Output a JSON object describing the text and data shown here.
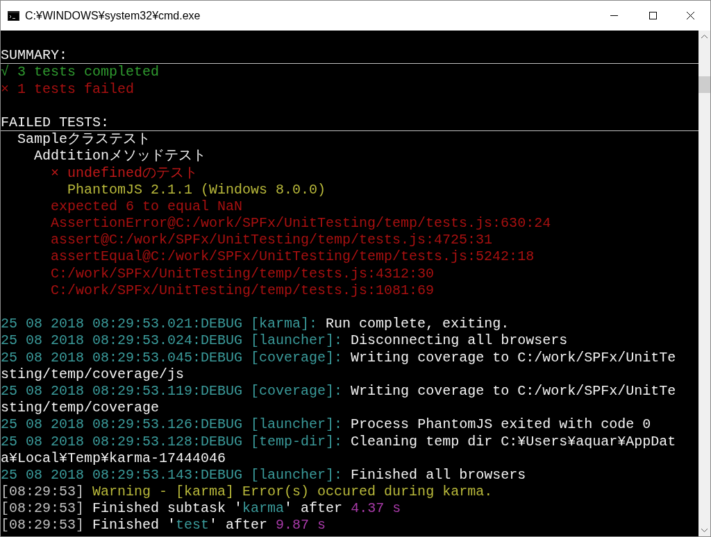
{
  "window": {
    "title": "C:¥WINDOWS¥system32¥cmd.exe"
  },
  "lines": [
    {
      "kind": "blank"
    },
    {
      "kind": "heading",
      "segments": [
        {
          "text": "SUMMARY:",
          "color": "#f2f2f2"
        }
      ]
    },
    {
      "kind": "text",
      "segments": [
        {
          "text": "√ 3 tests completed",
          "color": "#2f9a2f"
        }
      ]
    },
    {
      "kind": "text",
      "segments": [
        {
          "text": "× 1 tests failed",
          "color": "#a81010"
        }
      ]
    },
    {
      "kind": "blank"
    },
    {
      "kind": "heading",
      "segments": [
        {
          "text": "FAILED TESTS:",
          "color": "#f2f2f2"
        }
      ]
    },
    {
      "kind": "text",
      "segments": [
        {
          "text": "  Sampleクラステスト",
          "color": "#f2f2f2"
        }
      ]
    },
    {
      "kind": "text",
      "segments": [
        {
          "text": "    Addtitionメソッドテスト",
          "color": "#f2f2f2"
        }
      ]
    },
    {
      "kind": "text",
      "segments": [
        {
          "text": "      × undefinedのテスト",
          "color": "#c01818"
        }
      ]
    },
    {
      "kind": "text",
      "segments": [
        {
          "text": "        PhantomJS 2.1.1 (Windows 8.0.0)",
          "color": "#b8b83a"
        }
      ]
    },
    {
      "kind": "text",
      "segments": [
        {
          "text": "      expected 6 to equal NaN",
          "color": "#a81010"
        }
      ]
    },
    {
      "kind": "text",
      "segments": [
        {
          "text": "      AssertionError@C:/work/SPFx/UnitTesting/temp/tests.js:630:24",
          "color": "#a81010"
        }
      ]
    },
    {
      "kind": "text",
      "segments": [
        {
          "text": "      assert@C:/work/SPFx/UnitTesting/temp/tests.js:4725:31",
          "color": "#a81010"
        }
      ]
    },
    {
      "kind": "text",
      "segments": [
        {
          "text": "      assertEqual@C:/work/SPFx/UnitTesting/temp/tests.js:5242:18",
          "color": "#a81010"
        }
      ]
    },
    {
      "kind": "text",
      "segments": [
        {
          "text": "      C:/work/SPFx/UnitTesting/temp/tests.js:4312:30",
          "color": "#a81010"
        }
      ]
    },
    {
      "kind": "text",
      "segments": [
        {
          "text": "      C:/work/SPFx/UnitTesting/temp/tests.js:1081:69",
          "color": "#a81010"
        }
      ]
    },
    {
      "kind": "blank"
    },
    {
      "kind": "text",
      "segments": [
        {
          "text": "25 08 2018 08:29:53.021:DEBUG [karma]:",
          "color": "#3a9a9a"
        },
        {
          "text": " Run complete, exiting.",
          "color": "#f2f2f2"
        }
      ]
    },
    {
      "kind": "text",
      "segments": [
        {
          "text": "25 08 2018 08:29:53.024:DEBUG [launcher]:",
          "color": "#3a9a9a"
        },
        {
          "text": " Disconnecting all browsers",
          "color": "#f2f2f2"
        }
      ]
    },
    {
      "kind": "text",
      "segments": [
        {
          "text": "25 08 2018 08:29:53.045:DEBUG [coverage]:",
          "color": "#3a9a9a"
        },
        {
          "text": " Writing coverage to C:/work/SPFx/UnitTe",
          "color": "#f2f2f2"
        }
      ]
    },
    {
      "kind": "text",
      "segments": [
        {
          "text": "sting/temp/coverage/js",
          "color": "#f2f2f2"
        }
      ]
    },
    {
      "kind": "text",
      "segments": [
        {
          "text": "25 08 2018 08:29:53.119:DEBUG [coverage]:",
          "color": "#3a9a9a"
        },
        {
          "text": " Writing coverage to C:/work/SPFx/UnitTe",
          "color": "#f2f2f2"
        }
      ]
    },
    {
      "kind": "text",
      "segments": [
        {
          "text": "sting/temp/coverage",
          "color": "#f2f2f2"
        }
      ]
    },
    {
      "kind": "text",
      "segments": [
        {
          "text": "25 08 2018 08:29:53.126:DEBUG [launcher]:",
          "color": "#3a9a9a"
        },
        {
          "text": " Process PhantomJS exited with code 0",
          "color": "#f2f2f2"
        }
      ]
    },
    {
      "kind": "text",
      "segments": [
        {
          "text": "25 08 2018 08:29:53.128:DEBUG [temp-dir]:",
          "color": "#3a9a9a"
        },
        {
          "text": " Cleaning temp dir C:¥Users¥aquar¥AppDat",
          "color": "#f2f2f2"
        }
      ]
    },
    {
      "kind": "text",
      "segments": [
        {
          "text": "a¥Local¥Temp¥karma-17444046",
          "color": "#f2f2f2"
        }
      ]
    },
    {
      "kind": "text",
      "segments": [
        {
          "text": "25 08 2018 08:29:53.143:DEBUG [launcher]:",
          "color": "#3a9a9a"
        },
        {
          "text": " Finished all browsers",
          "color": "#f2f2f2"
        }
      ]
    },
    {
      "kind": "text",
      "segments": [
        {
          "text": "[08:29:53]",
          "color": "#c0c0c0"
        },
        {
          "text": " Warning - [karma] Error(s) occured during karma.",
          "color": "#b8b83a"
        }
      ]
    },
    {
      "kind": "text",
      "segments": [
        {
          "text": "[08:29:53]",
          "color": "#c0c0c0"
        },
        {
          "text": " Finished subtask '",
          "color": "#f2f2f2"
        },
        {
          "text": "karma",
          "color": "#3a9a9a"
        },
        {
          "text": "' after ",
          "color": "#f2f2f2"
        },
        {
          "text": "4.37 s",
          "color": "#a83aa8"
        }
      ]
    },
    {
      "kind": "text",
      "segments": [
        {
          "text": "[08:29:53]",
          "color": "#c0c0c0"
        },
        {
          "text": " Finished '",
          "color": "#f2f2f2"
        },
        {
          "text": "test",
          "color": "#3a9a9a"
        },
        {
          "text": "' after ",
          "color": "#f2f2f2"
        },
        {
          "text": "9.87 s",
          "color": "#a83aa8"
        }
      ]
    }
  ]
}
